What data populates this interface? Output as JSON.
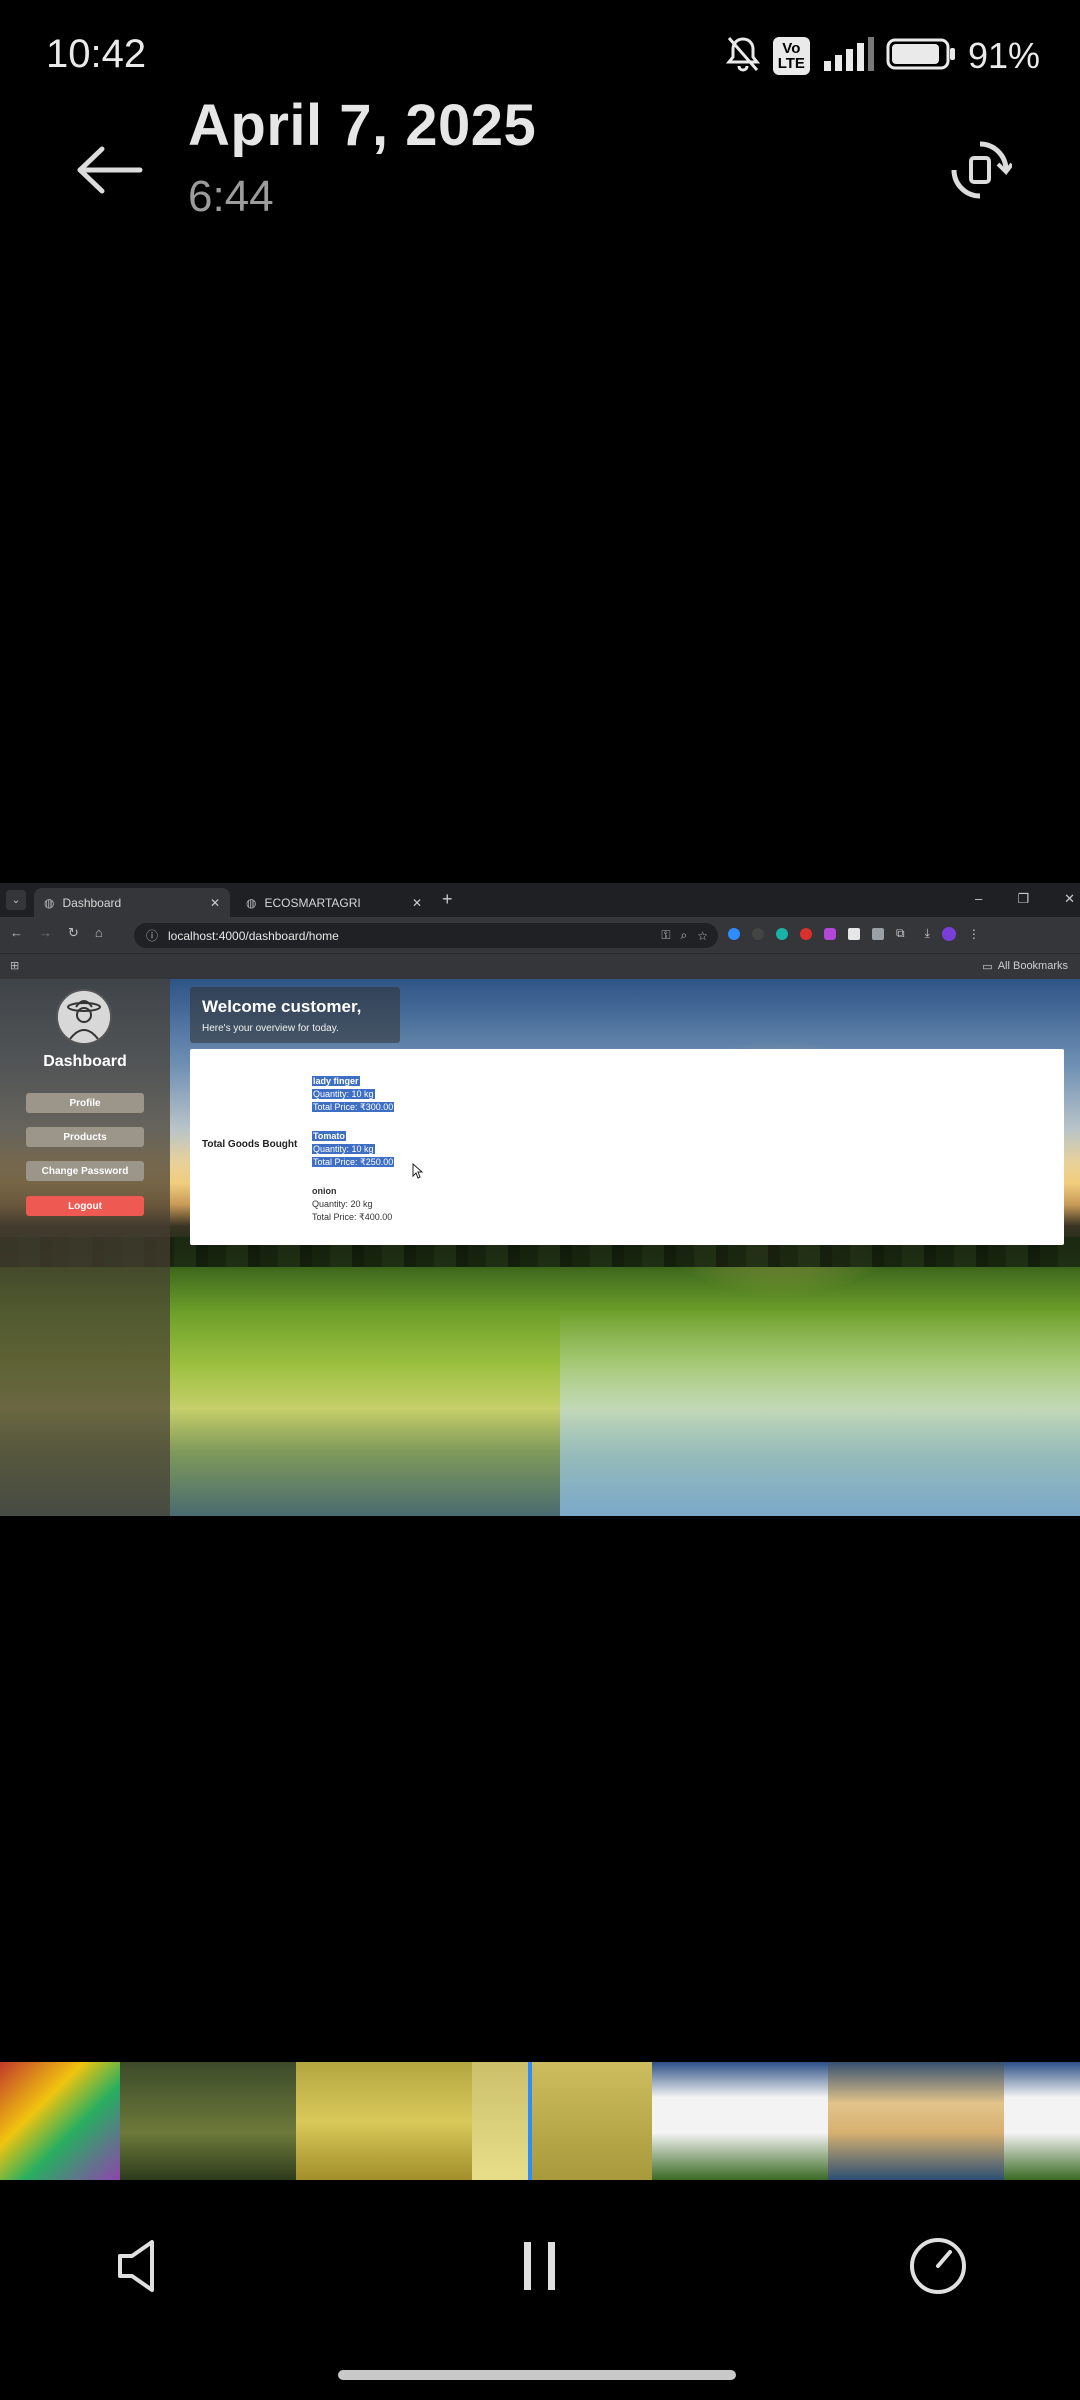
{
  "status_bar": {
    "time": "10:42",
    "volte_line1": "Vo",
    "volte_line2": "LTE",
    "battery_percent": "91%",
    "battery_level": 0.91
  },
  "viewer": {
    "date": "April 7, 2025",
    "duration": "6:44"
  },
  "browser": {
    "tabs": [
      {
        "label": "Dashboard",
        "active": true
      },
      {
        "label": "ECOSMARTAGRI",
        "active": false
      }
    ],
    "new_tab_symbol": "+",
    "url": "localhost:4000/dashboard/home",
    "all_bookmarks": "All Bookmarks",
    "window_controls": [
      "–",
      "❐",
      "✕"
    ]
  },
  "dashboard": {
    "sidebar_title": "Dashboard",
    "menu": [
      "Profile",
      "Products",
      "Change Password",
      "Logout"
    ],
    "welcome_title": "Welcome customer,",
    "welcome_subtitle": "Here's your overview for today.",
    "goods_label": "Total Goods Bought",
    "goods": [
      {
        "name": "lady finger",
        "quantity": "Quantity: 10 kg",
        "price": "Total Price: ₹300.00",
        "selected": true
      },
      {
        "name": "Tomato",
        "quantity": "Quantity: 10 kg",
        "price": "Total Price: ₹250.00",
        "selected": true
      },
      {
        "name": "onion",
        "quantity": "Quantity: 20 kg",
        "price": "Total Price: ₹400.00",
        "selected": false
      }
    ]
  },
  "colors": {
    "background": "#000000",
    "logout_button": "#ee5a52",
    "selection": "#3f6fc4",
    "timeline_playhead": "#2f8cff"
  },
  "icons": [
    "back-arrow-icon",
    "rotate-screen-icon",
    "volume-icon",
    "pause-icon",
    "speed-icon",
    "bell-off-icon",
    "signal-icon",
    "battery-icon"
  ]
}
